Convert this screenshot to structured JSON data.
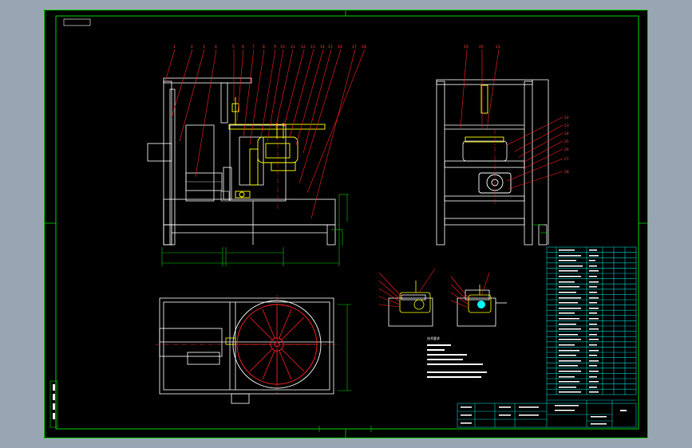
{
  "window": {
    "background": "#9aa5b3"
  },
  "colors": {
    "sheet": "#000000",
    "border": "#00d000",
    "lines": "#ffffff",
    "leaders": "#ff2020",
    "parts": "#ffff00",
    "centerline": "#ff3030",
    "table": "#00c8c8",
    "accent": "#00ffff"
  },
  "drawing": {
    "balloons_front": [
      "1",
      "2",
      "3",
      "4",
      "5",
      "6",
      "7",
      "8",
      "9",
      "10",
      "11",
      "12",
      "13",
      "14",
      "15",
      "16",
      "17",
      "18"
    ],
    "balloons_side_top": [
      "19",
      "20",
      "21"
    ],
    "balloons_side_right": [
      "22",
      "23",
      "24",
      "25",
      "26",
      "27",
      "28"
    ],
    "notes_heading": "技术要求",
    "icons": [
      "motor-icon",
      "gearbox-icon",
      "turntable-icon"
    ]
  }
}
